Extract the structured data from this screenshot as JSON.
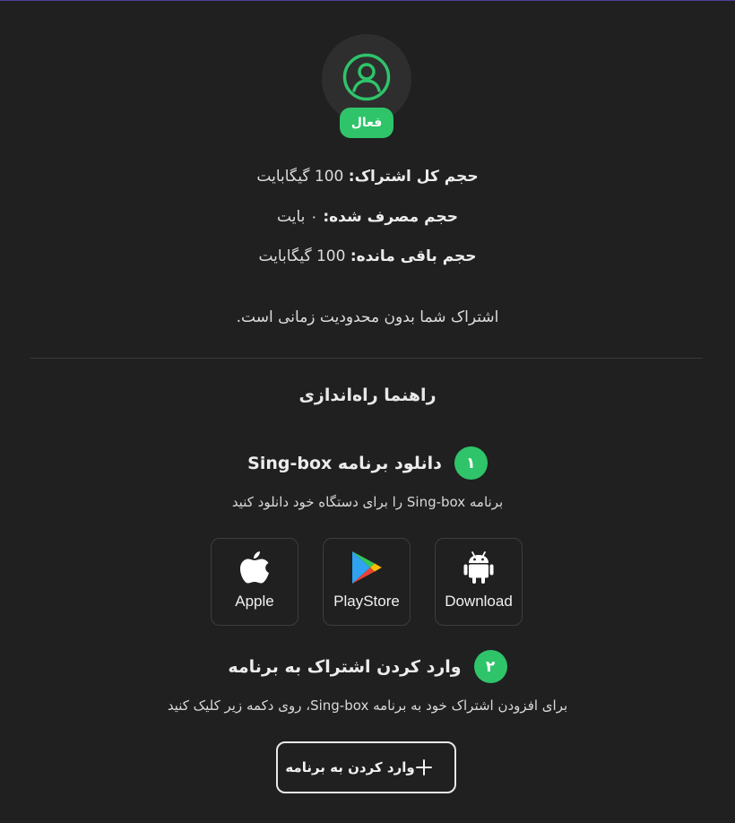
{
  "profile": {
    "avatar_icon": "user-circle-icon",
    "status_badge": "فعال",
    "status_color": "#2fc46a"
  },
  "stats": {
    "total_label": "حجم کل اشتراک:",
    "total_value": "100 گیگابایت",
    "used_label": "حجم مصرف شده:",
    "used_value": "۰ بایت",
    "remaining_label": "حجم باقی مانده:",
    "remaining_value": "100 گیگابایت"
  },
  "subscription_note": "اشتراک شما بدون محدودیت زمانی است.",
  "guide": {
    "title": "راهنما راه‌اندازی",
    "step1": {
      "number": "۱",
      "title": "دانلود برنامه Sing-box",
      "description": "برنامه Sing-box را برای دستگاه خود دانلود کنید"
    },
    "apps": [
      {
        "label": "Download",
        "icon": "android-icon"
      },
      {
        "label": "PlayStore",
        "icon": "google-play-icon"
      },
      {
        "label": "Apple",
        "icon": "apple-icon"
      }
    ],
    "step2": {
      "number": "۲",
      "title": "وارد کردن اشتراک به برنامه",
      "description": "برای افزودن اشتراک خود به برنامه Sing-box، روی دکمه زیر کلیک کنید"
    },
    "import_button": {
      "label": "وارد کردن به برنامه",
      "icon": "plus-icon"
    }
  }
}
